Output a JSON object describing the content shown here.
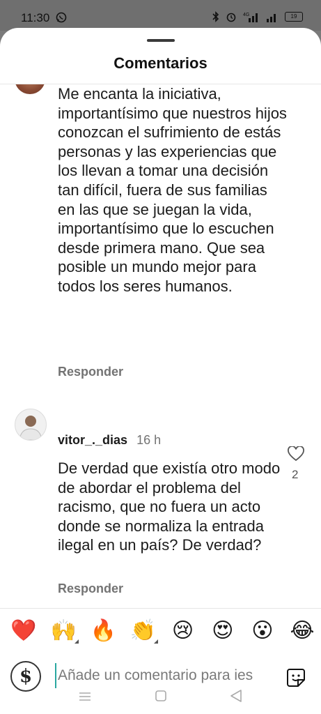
{
  "status_bar": {
    "time": "11:30",
    "battery": "19"
  },
  "sheet": {
    "title": "Comentarios"
  },
  "comments": [
    {
      "text": "Me encanta la iniciativa, importantísimo que nuestros hijos conozcan el sufrimiento de estás personas y las experiencias que los llevan a tomar una decisión tan difícil, fuera de sus familias en las que se juegan la vida, importantísimo que lo escuchen desde primera mano. Que sea posible un mundo mejor para todos los seres humanos.",
      "reply_label": "Responder"
    },
    {
      "username": "vitor_._dias",
      "time": "16 h",
      "text": "De verdad que existía otro modo de abordar el problema del racismo, que no fuera un acto donde se normaliza la entrada ilegal en un país? De verdad?",
      "likes": "2",
      "reply_label": "Responder"
    }
  ],
  "reactions": [
    "❤️",
    "🙌",
    "🔥",
    "👏",
    "😢",
    "😍",
    "😮",
    "😂"
  ],
  "composer": {
    "avatar_glyph": "$",
    "placeholder": "Añade un comentario para ies"
  },
  "colors": {
    "accent": "#2aa7a0",
    "muted": "#737373"
  }
}
